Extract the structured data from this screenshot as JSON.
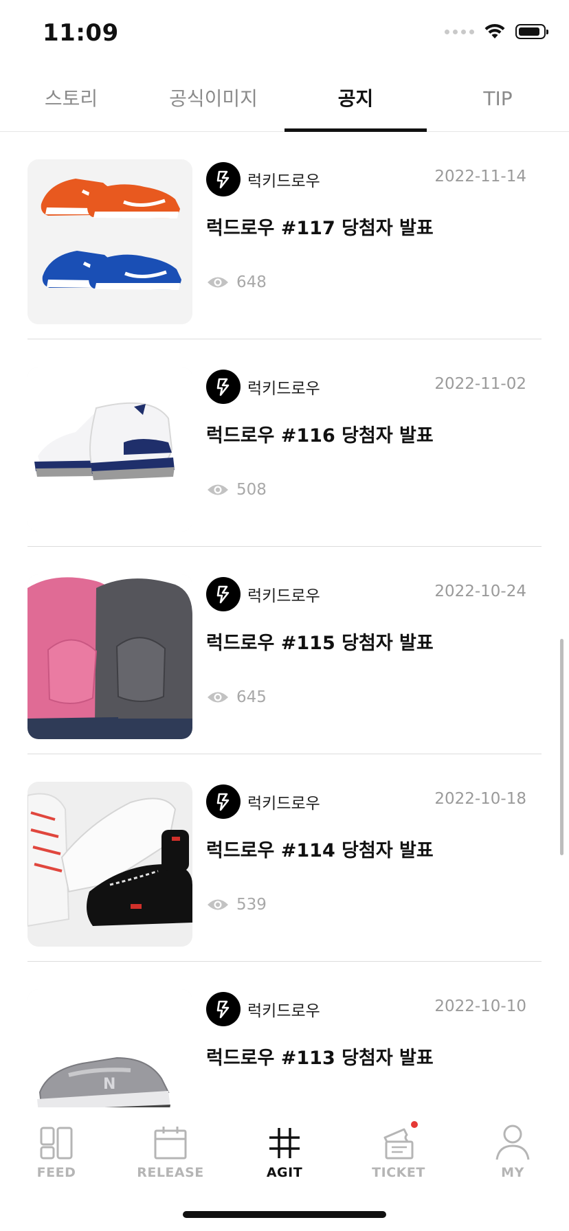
{
  "status_bar": {
    "time": "11:09"
  },
  "tabs": [
    {
      "label": "스토리",
      "active": false
    },
    {
      "label": "공식이미지",
      "active": false
    },
    {
      "label": "공지",
      "active": true
    },
    {
      "label": "TIP",
      "active": false
    }
  ],
  "posts": [
    {
      "author": "럭키드로우",
      "date": "2022-11-14",
      "title": "럭드로우 #117 당첨자 발표",
      "views": "648",
      "thumbnail": "orange-and-blue-dunk-sneakers"
    },
    {
      "author": "럭키드로우",
      "date": "2022-11-02",
      "title": "럭드로우 #116 당첨자 발표",
      "views": "508",
      "thumbnail": "white-navy-jordan-4-sneaker"
    },
    {
      "author": "럭키드로우",
      "date": "2022-10-24",
      "title": "럭드로우 #115 당첨자 발표",
      "views": "645",
      "thumbnail": "pink-and-grey-hoodie-backpacks"
    },
    {
      "author": "럭키드로우",
      "date": "2022-10-18",
      "title": "럭드로우 #114 당첨자 발표",
      "views": "539",
      "thumbnail": "white-and-black-af1-sneakers"
    },
    {
      "author": "럭키드로우",
      "date": "2022-10-10",
      "title": "럭드로우 #113 당첨자 발표",
      "views": "",
      "thumbnail": "grey-new-balance-sneaker"
    }
  ],
  "bottom_nav": [
    {
      "label": "FEED",
      "icon": "feed-grid-icon",
      "active": false
    },
    {
      "label": "RELEASE",
      "icon": "calendar-icon",
      "active": false
    },
    {
      "label": "AGIT",
      "icon": "hashtag-icon",
      "active": true
    },
    {
      "label": "TICKET",
      "icon": "ticket-icon",
      "active": false,
      "badge": true
    },
    {
      "label": "MY",
      "icon": "user-icon",
      "active": false
    }
  ],
  "colors": {
    "accent": "#111111",
    "muted": "#9a9a9a",
    "badge": "#e53935"
  }
}
